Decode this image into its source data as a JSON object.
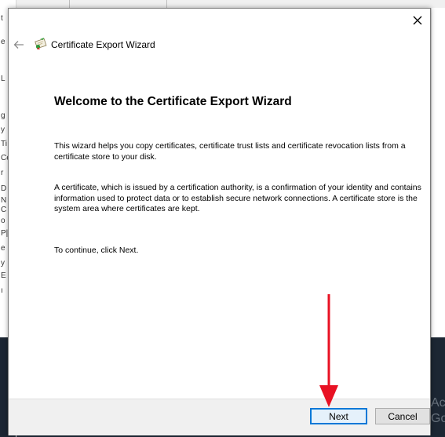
{
  "background": {
    "left_fragments": [
      "t",
      "e",
      "L",
      "g",
      "y",
      "Ti",
      "Ce",
      "r",
      "D",
      "N",
      "C",
      "o",
      "P|",
      "e",
      "y",
      "E",
      "ı"
    ],
    "right_ghost": [
      "Ac",
      "Go"
    ]
  },
  "dialog": {
    "title": "Certificate Export Wizard",
    "heading": "Welcome to the Certificate Export Wizard",
    "paragraph1": "This wizard helps you copy certificates, certificate trust lists and certificate revocation lists from a certificate store to your disk.",
    "paragraph2": "A certificate, which is issued by a certification authority, is a confirmation of your identity and contains information used to protect data or to establish secure network connections. A certificate store is the system area where certificates are kept.",
    "paragraph3": "To continue, click Next.",
    "buttons": {
      "next": "Next",
      "cancel": "Cancel"
    },
    "icons": {
      "close": "close-icon",
      "back": "back-arrow-icon",
      "wizard": "certificate-wizard-icon"
    }
  },
  "annotation": {
    "arrow_color": "#e81123"
  },
  "colors": {
    "accent": "#0078d7",
    "footer": "#f0f0f0"
  }
}
